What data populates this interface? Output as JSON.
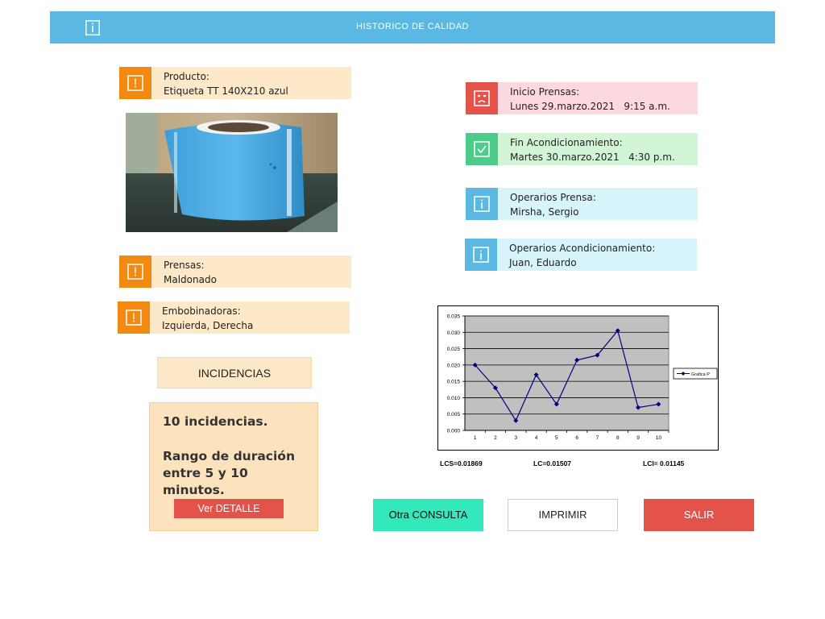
{
  "header": {
    "title": "HISTORICO DE CALIDAD",
    "icon": "info-icon"
  },
  "producto": {
    "label": "Producto:",
    "value": "Etiqueta TT 140X210 azul",
    "icon": "alert-icon"
  },
  "prensas": {
    "label": "Prensas:",
    "value": "Maldonado",
    "icon": "alert-icon"
  },
  "embobinadoras": {
    "label": "Embobinadoras:",
    "value": "Izquierda, Derecha",
    "icon": "alert-icon"
  },
  "inicio_prensas": {
    "label": "Inicio Prensas:",
    "value": "Lunes 29.marzo.2021   9:15 a.m.",
    "icon": "sad-face-icon"
  },
  "fin_acond": {
    "label": "Fin Acondicionamiento:",
    "value": "Martes 30.marzo.2021   4:30 p.m.",
    "icon": "check-icon"
  },
  "operarios_prensa": {
    "label": "Operarios Prensa:",
    "value": "Mirsha, Sergio",
    "icon": "info-icon"
  },
  "operarios_acond": {
    "label": "Operarios Acondicionamiento:",
    "value": "Juan, Eduardo",
    "icon": "info-icon"
  },
  "incidencias": {
    "title": "INCIDENCIAS",
    "count_text": "10 incidencias.",
    "range_text": "Rango de duración entre 5 y 10 minutos.",
    "detail_button": "Ver DETALLE"
  },
  "chart_data": {
    "type": "line",
    "x": [
      1,
      2,
      3,
      4,
      5,
      6,
      7,
      8,
      9,
      10
    ],
    "series": [
      {
        "name": "Grafica P",
        "values": [
          0.02,
          0.013,
          0.003,
          0.017,
          0.008,
          0.0215,
          0.023,
          0.0305,
          0.007,
          0.008
        ]
      }
    ],
    "ylim": [
      0,
      0.035
    ],
    "yticks": [
      "0.000",
      "0.005",
      "0.010",
      "0.015",
      "0.020",
      "0.025",
      "0.030",
      "0.035"
    ],
    "grid": true,
    "legend": "right",
    "colors": {
      "line": "#000080",
      "plot_bg": "#c0c0c0"
    }
  },
  "stats": {
    "lcs": "LCS=0.01869",
    "lc": "LC=0.01507",
    "lci": "LCI= 0.01145"
  },
  "buttons": {
    "otra": "Otra CONSULTA",
    "imprimir": "IMPRIMIR",
    "salir": "SALIR"
  }
}
